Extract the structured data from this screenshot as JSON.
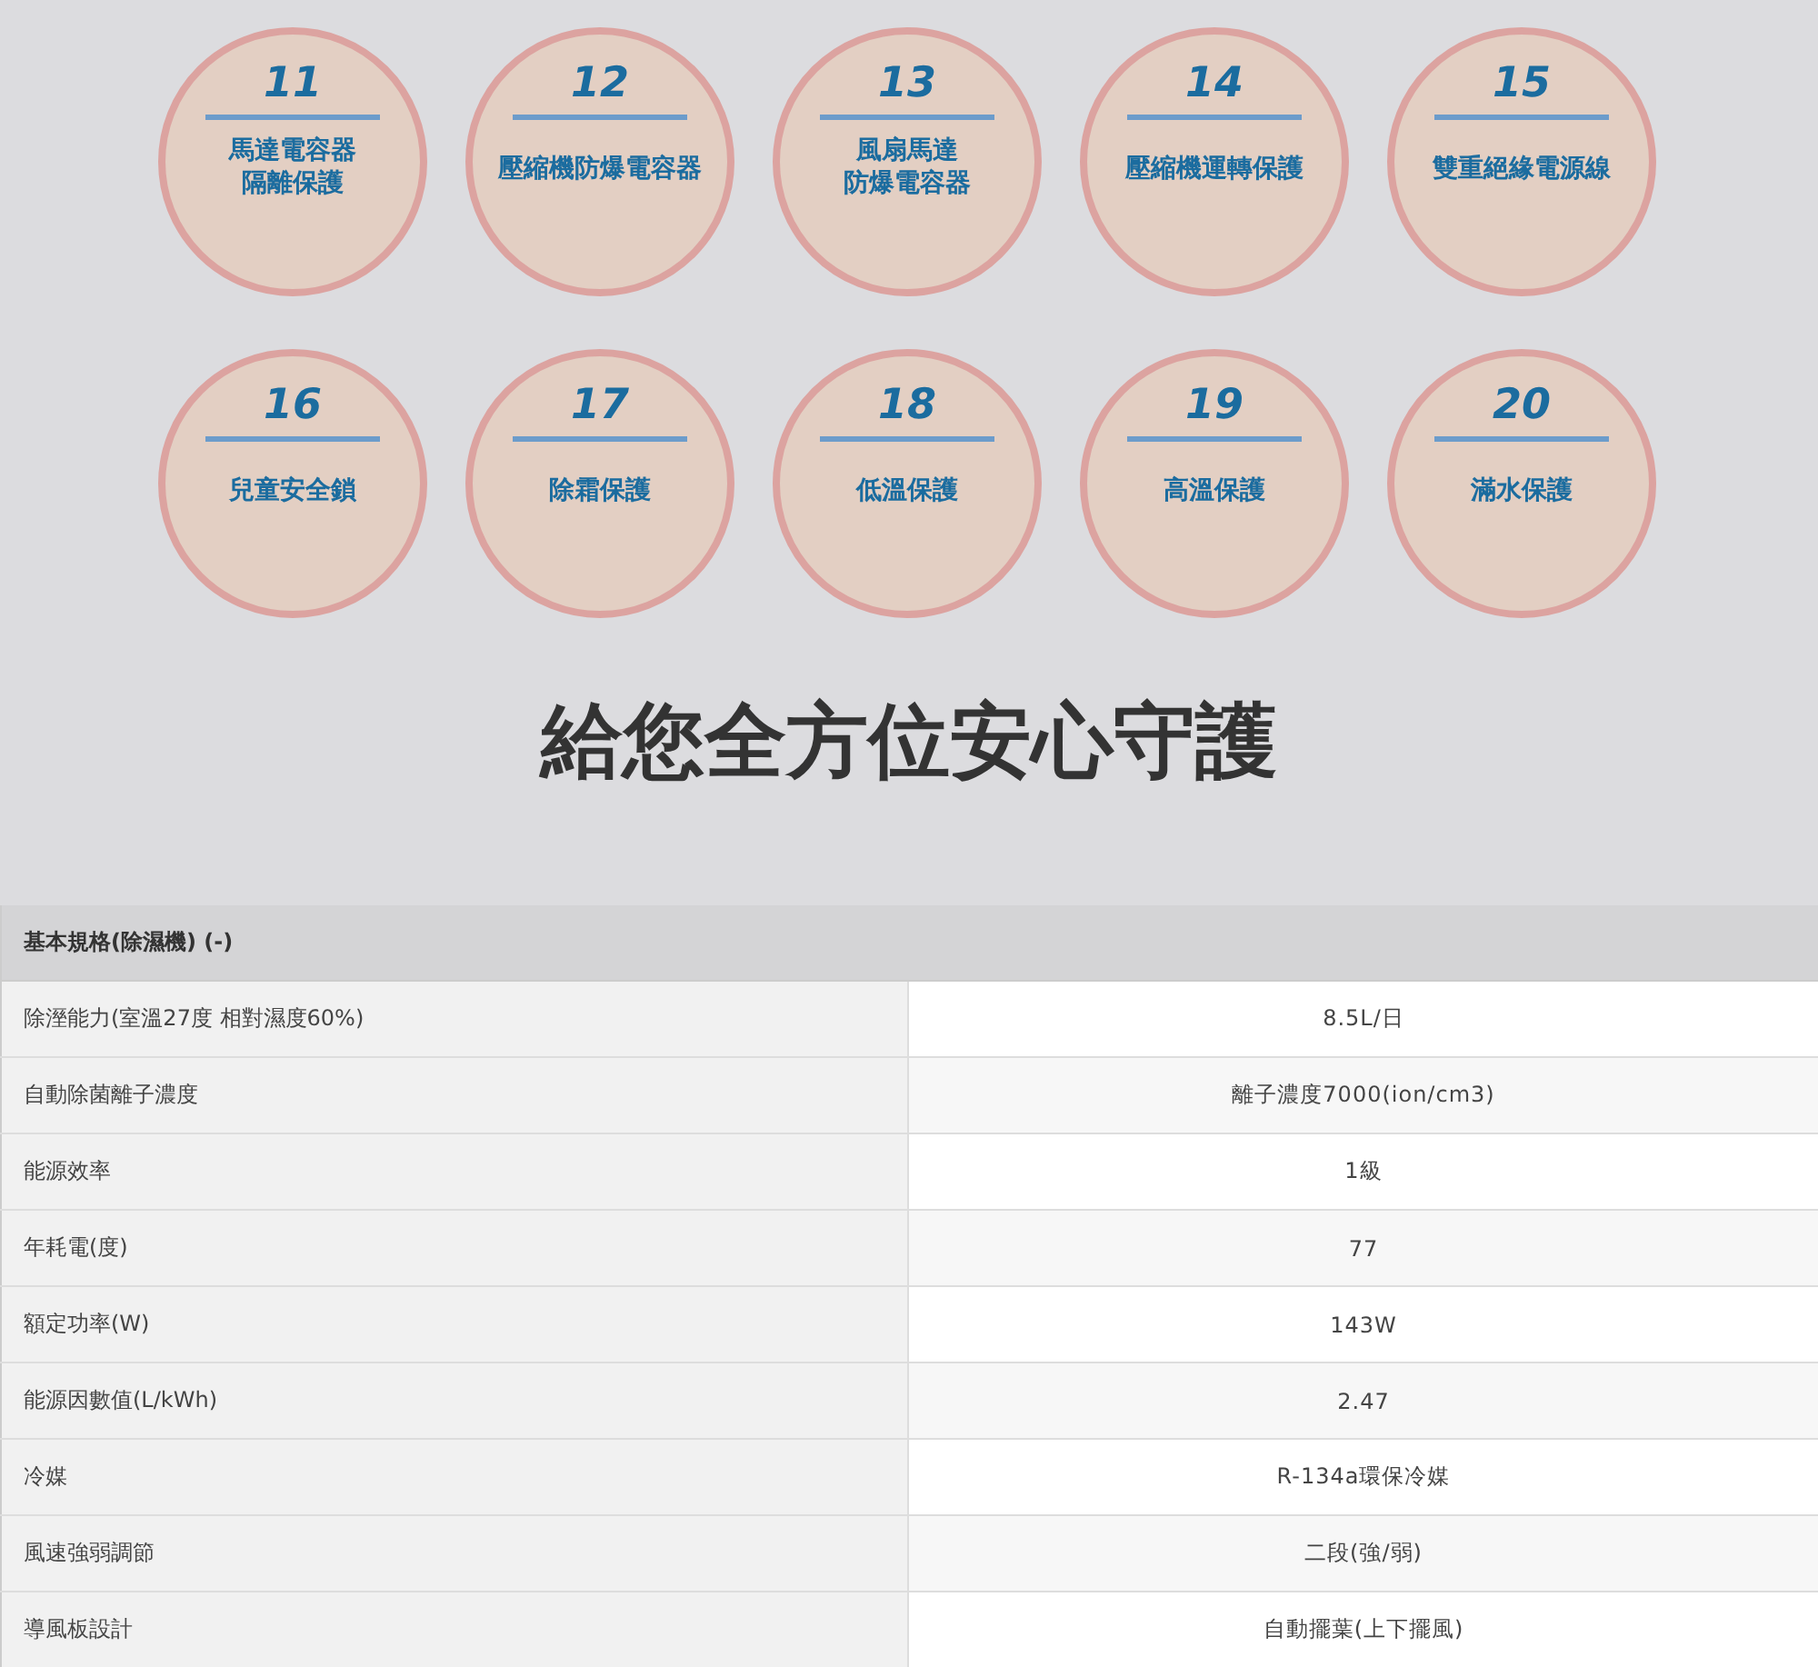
{
  "features": [
    {
      "number": "11",
      "label": [
        "馬達電容器",
        "隔離保護"
      ]
    },
    {
      "number": "12",
      "label": [
        "壓縮機防爆電容器"
      ]
    },
    {
      "number": "13",
      "label": [
        "風扇馬達",
        "防爆電容器"
      ]
    },
    {
      "number": "14",
      "label": [
        "壓縮機運轉保護"
      ]
    },
    {
      "number": "15",
      "label": [
        "雙重絕緣電源線"
      ]
    },
    {
      "number": "16",
      "label": [
        "兒童安全鎖"
      ]
    },
    {
      "number": "17",
      "label": [
        "除霜保護"
      ]
    },
    {
      "number": "18",
      "label": [
        "低溫保護"
      ]
    },
    {
      "number": "19",
      "label": [
        "高溫保護"
      ]
    },
    {
      "number": "20",
      "label": [
        "滿水保護"
      ]
    }
  ],
  "headline": "給您全方位安心守護",
  "spec_table": {
    "title": "基本規格(除濕機) (-)",
    "rows": [
      {
        "name": "除溼能力(室溫27度 相對濕度60%)",
        "value": "8.5L/日"
      },
      {
        "name": "自動除菌離子濃度",
        "value": "離子濃度7000(ion/cm3)"
      },
      {
        "name": "能源效率",
        "value": "1級"
      },
      {
        "name": "年耗電(度)",
        "value": "77"
      },
      {
        "name": "額定功率(W)",
        "value": "143W"
      },
      {
        "name": "能源因數值(L/kWh)",
        "value": "2.47"
      },
      {
        "name": "冷媒",
        "value": "R-134a環保冷媒"
      },
      {
        "name": "風速強弱調節",
        "value": "二段(強/弱)"
      },
      {
        "name": "導風板設計",
        "value": "自動擺葉(上下擺風)"
      }
    ]
  }
}
